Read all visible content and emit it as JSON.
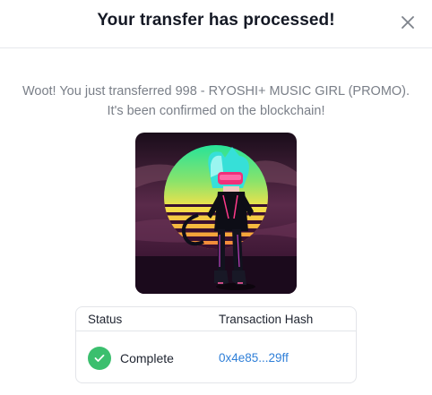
{
  "header": {
    "title": "Your transfer has processed!",
    "close_icon": "close-icon"
  },
  "message": {
    "line1": "Woot! You just transferred 998 - RYOSHI+ MUSIC GIRL (PROMO).",
    "line2": "It's been confirmed on the blockchain!"
  },
  "nft": {
    "image_icon": "nft-artwork"
  },
  "table": {
    "headers": [
      "Status",
      "Transaction Hash"
    ],
    "row": {
      "status": "Complete",
      "status_icon": "check-icon",
      "hash": "0x4e85...29ff"
    }
  },
  "colors": {
    "success": "#3bbf6e",
    "link": "#2f7fd8",
    "muted_text": "#7a7f88"
  }
}
